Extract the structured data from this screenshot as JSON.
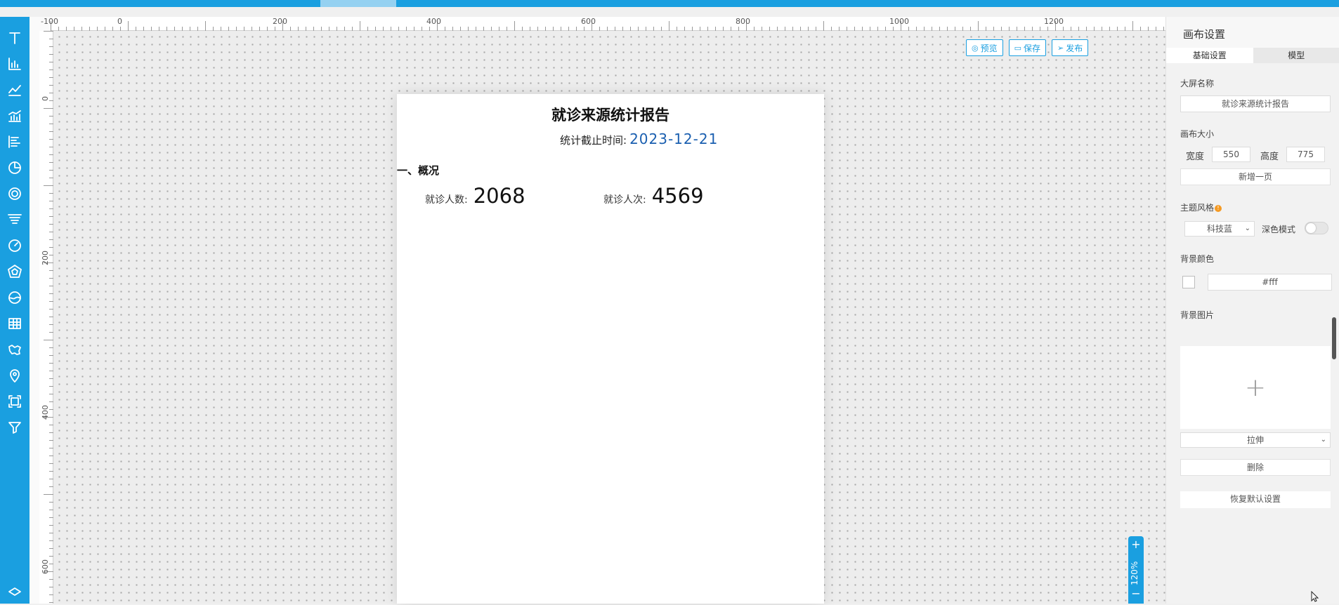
{
  "toolbar": {
    "tools": [
      "text-icon",
      "bar-chart-icon",
      "line-chart-icon",
      "combo-chart-icon",
      "horizontal-bar-icon",
      "pie-chart-icon",
      "ring-chart-icon",
      "funnel-icon",
      "gauge-icon",
      "radar-icon",
      "water-ball-icon",
      "table-icon",
      "map-icon",
      "location-pin-icon",
      "frame-icon",
      "filter-icon",
      "layers-icon"
    ]
  },
  "ruler": {
    "top_labels": [
      "-100",
      "0",
      "200",
      "400",
      "600",
      "800",
      "1000",
      "1200"
    ],
    "left_labels": [
      "0",
      "200",
      "400",
      "600"
    ]
  },
  "actions": {
    "preview": "预览",
    "save": "保存",
    "publish": "发布"
  },
  "report": {
    "title": "就诊来源统计报告",
    "date_label": "统计截止时间:",
    "date_value": "2023-12-21",
    "section": "一、概况",
    "patients_label": "就诊人数:",
    "patients_value": "2068",
    "visits_label": "就诊人次:",
    "visits_value": "4569"
  },
  "zoom": {
    "plus": "+",
    "level": "120%",
    "minus": "−"
  },
  "panel": {
    "title": "画布设置",
    "tabs": [
      "基础设置",
      "模型"
    ],
    "screen_name_label": "大屏名称",
    "screen_name_value": "就诊来源统计报告",
    "canvas_size_label": "画布大小",
    "width_label": "宽度",
    "width_value": "550",
    "height_label": "高度",
    "height_value": "775",
    "add_page": "新增一页",
    "theme_label": "主题风格",
    "theme_value": "科技蓝",
    "dark_mode_label": "深色模式",
    "bg_color_label": "背景颜色",
    "bg_color_value": "#fff",
    "bg_image_label": "背景图片",
    "fit_value": "拉伸",
    "delete": "删除",
    "reset": "恢复默认设置"
  },
  "colors": {
    "accent": "#1a9fe0",
    "date_blue": "#1a5fb0"
  }
}
